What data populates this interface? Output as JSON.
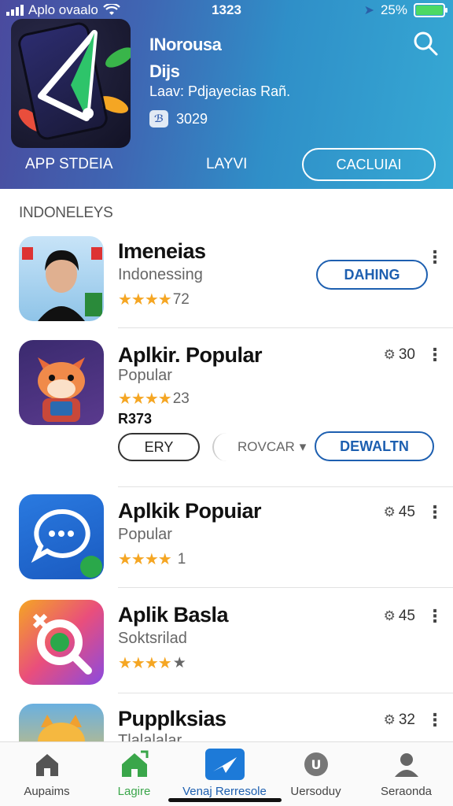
{
  "status_bar": {
    "carrier": "Aplo ovaalo",
    "time": "1323",
    "battery": "25%"
  },
  "header": {
    "title_line1": "INorousa",
    "title_line2": "Dijs",
    "subtitle": "Laav: Pdjayecias Rañ.",
    "meta_icon_label": "ℬ",
    "meta_value": "3029",
    "tab_left": "APP STDEIA",
    "tab_center": "LAYVI",
    "cta_label": "CACLUIAI"
  },
  "section": {
    "title": "INDONELEYS"
  },
  "apps": [
    {
      "name": "Imeneias",
      "category": "Indonessing",
      "stars": "★★★★",
      "rating": "72",
      "button": "DAHING"
    },
    {
      "name": "Aplkir. Popular",
      "category": "Popular",
      "stars": "★★★★",
      "rating": "23",
      "price": "R373",
      "size": "30",
      "btn_secondary": "ERY",
      "select_value": "ROVCAR",
      "button": "DEWALTN"
    },
    {
      "name": "Aplkik Popuiar",
      "category": "Popular",
      "stars": "★★★★",
      "rating": "1",
      "size": "45"
    },
    {
      "name": "Aplik Basla",
      "category": "Soktsrilad",
      "stars": "★★★★",
      "rating": "★",
      "size": "45"
    },
    {
      "name": "Pupplksias",
      "category": "Tlalalalar",
      "size": "32"
    }
  ],
  "bottom_nav": [
    {
      "label": "Aupaims",
      "icon": "home-icon"
    },
    {
      "label": "Lagire",
      "icon": "home-green-icon"
    },
    {
      "label": "Venaj Rerresole",
      "icon": "send-icon"
    },
    {
      "label": "Uersoduy",
      "icon": "updates-icon"
    },
    {
      "label": "Seraonda",
      "icon": "person-icon"
    }
  ],
  "colors": {
    "header_start": "#4a4a9e",
    "header_end": "#36a9d4",
    "accent": "#1d5fb0",
    "star": "#f5a623",
    "green": "#3aa64a"
  }
}
